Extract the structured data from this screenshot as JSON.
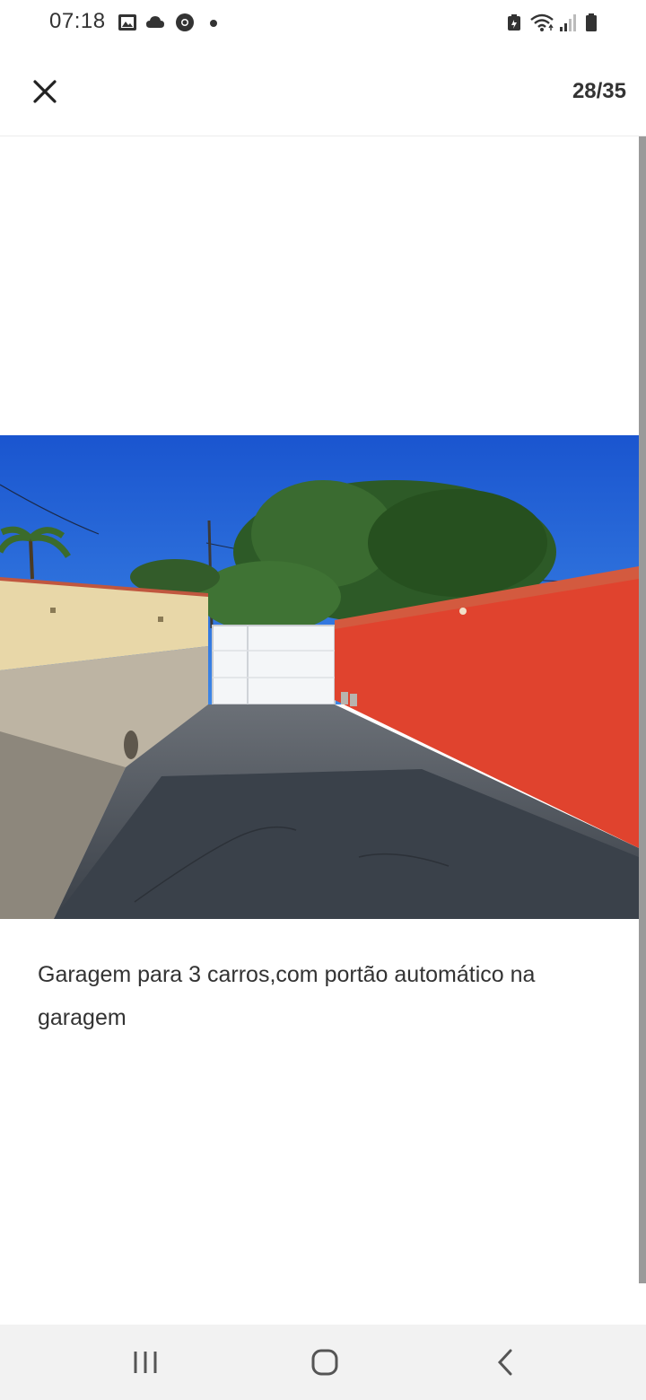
{
  "status_bar": {
    "time": "07:18",
    "left_icons": [
      "gallery-icon",
      "cloud-icon",
      "chrome-icon",
      "notification-dot"
    ],
    "right_icons": [
      "battery-saver-icon",
      "wifi-icon",
      "signal-icon",
      "battery-icon"
    ]
  },
  "header": {
    "close_icon": "close-icon",
    "counter": "28/35"
  },
  "photo": {
    "subject": "garage-driveway-photo",
    "colors": {
      "sky": "#1f5fd6",
      "red_wall": "#e0432e",
      "beige_wall": "#e8d7a8",
      "pavement": "#4b525c"
    }
  },
  "caption": {
    "text": "Garagem para 3 carros,com portão automático na garagem"
  },
  "nav_bar": {
    "recent_icon": "recent-apps-icon",
    "home_icon": "home-icon",
    "back_icon": "back-icon"
  }
}
